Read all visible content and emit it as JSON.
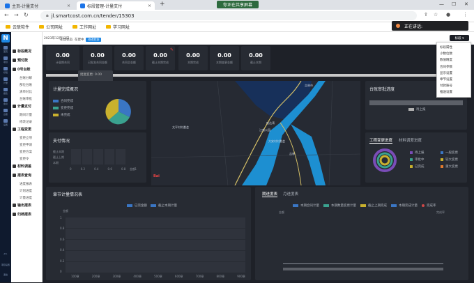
{
  "browser": {
    "tabs": [
      {
        "label": "主页-计量支付",
        "active": false
      },
      {
        "label": "标段管理-计量支付",
        "active": true
      }
    ],
    "share_banner": "你正在共享屏幕",
    "url": "jl.smartcost.com.cn/tender/15303",
    "bookmarks": [
      "云联软件",
      "公司网址",
      "工作网址",
      "学习网址"
    ],
    "speaking": "正在讲话:"
  },
  "app": {
    "side_icons": [
      "首页",
      "项目",
      "标段",
      "计量",
      "报表",
      "会议",
      "台账",
      "设置"
    ],
    "bottom_icons": [
      "JCL",
      "项目设置",
      "退出"
    ],
    "menu": [
      {
        "type": "h",
        "label": "标段概况"
      },
      {
        "type": "h",
        "label": "预付款"
      },
      {
        "type": "h",
        "label": "0号台账"
      },
      {
        "type": "i",
        "label": "台账分解"
      },
      {
        "type": "i",
        "label": "部位台账"
      },
      {
        "type": "i",
        "label": "清单对比"
      },
      {
        "type": "i",
        "label": "台账审批"
      },
      {
        "type": "h",
        "label": "计量支付"
      },
      {
        "type": "i",
        "label": "期间计量"
      },
      {
        "type": "i",
        "label": "修改记录"
      },
      {
        "type": "h",
        "label": "工程变更"
      },
      {
        "type": "i",
        "label": "变更立项"
      },
      {
        "type": "i",
        "label": "变更申请"
      },
      {
        "type": "i",
        "label": "变更方案"
      },
      {
        "type": "i",
        "label": "变更令"
      },
      {
        "type": "h",
        "label": "材料调差"
      },
      {
        "type": "h",
        "label": "报表查询"
      },
      {
        "type": "i",
        "label": "进度报表"
      },
      {
        "type": "i",
        "label": "计划进度"
      },
      {
        "type": "i",
        "label": "计量进度"
      },
      {
        "type": "h",
        "label": "输出报表"
      },
      {
        "type": "h",
        "label": "归档报表"
      }
    ],
    "date_info": "2023年12月12日",
    "status_a": "在建状态: 在建中",
    "tag_button": "修改状态",
    "dropdown_button": "标段 ▾",
    "dropdown_items": [
      "标段属性",
      "小数位数",
      "数值精度",
      "合同参数",
      "显示设置",
      "章节设置",
      "付款账号",
      "推送设置"
    ],
    "stats": [
      {
        "value": "0.00",
        "label": "计量期合同"
      },
      {
        "value": "0.00",
        "label": "已批准合同金额"
      },
      {
        "value": "0.00",
        "label": "合同总金额"
      },
      {
        "value": "0.00",
        "label": "截止本期完成"
      },
      {
        "value": "0.00",
        "label": "本期完成"
      },
      {
        "value": "0.00",
        "label": "本期变更金额"
      },
      {
        "value": "0.00",
        "label": "截止本期"
      }
    ],
    "tooltip": [
      "批复变更: 0.00",
      "批复变更: 0.00"
    ],
    "panels": {
      "measure": {
        "title": "计量完成概况",
        "legend": [
          "合同完成",
          "变更完成",
          "未完成"
        ],
        "colors": [
          "#3a76c4",
          "#3aa28f",
          "#c9b12e"
        ]
      },
      "payment": {
        "title": "支付情况",
        "ylabels": [
          "截止本期",
          "截止上期",
          "本期"
        ],
        "xticks": [
          "0",
          "0.2",
          "0.4",
          "0.6",
          "0.8",
          "1"
        ],
        "unit": "金额"
      },
      "map": {
        "places": [
          "吉林市",
          "太平村村委会",
          "哈达湾",
          "江南公园",
          "大安村村委会",
          "吉林"
        ]
      },
      "progress": {
        "title": "台账审批进度",
        "badge": "待上报"
      },
      "change": {
        "tabs": [
          "工程变更进度",
          "材料调差进度"
        ],
        "legend_left": [
          "待上报",
          "审批中",
          "已完成"
        ],
        "legend_right": [
          "一般变更",
          "较大变更",
          "重大变更"
        ]
      },
      "chapter": {
        "title": "章节计量情况表",
        "legend": [
          "已完金额",
          "截止本期计量"
        ],
        "y_top": "金额",
        "yticks": [
          "1",
          "0.8",
          "0.6",
          "0.4",
          "0.2",
          "0"
        ],
        "xticks": [
          "100章",
          "200章",
          "300章",
          "400章",
          "500章",
          "600章",
          "700章",
          "800章",
          "900章"
        ]
      },
      "schedule": {
        "tabs": [
          "期进度表",
          "月进度表"
        ],
        "legend": [
          "本期合同计量",
          "本期数量变更计量",
          "截止上期完成",
          "本期完成计量",
          "完成率"
        ],
        "y_left": "金额",
        "y_right": "完成率"
      }
    }
  }
}
